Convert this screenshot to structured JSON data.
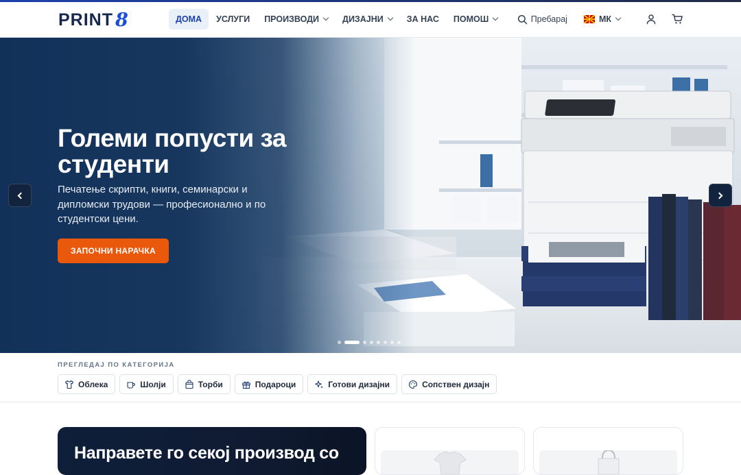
{
  "brand": {
    "name": "PRINT",
    "digit": "8"
  },
  "nav": {
    "items": [
      {
        "label": "ДОМА",
        "active": true,
        "has_dropdown": false
      },
      {
        "label": "УСЛУГИ",
        "active": false,
        "has_dropdown": false
      },
      {
        "label": "ПРОИЗВОДИ",
        "active": false,
        "has_dropdown": true
      },
      {
        "label": "ДИЗАЈНИ",
        "active": false,
        "has_dropdown": true
      },
      {
        "label": "ЗА НАС",
        "active": false,
        "has_dropdown": false
      },
      {
        "label": "ПОМОШ",
        "active": false,
        "has_dropdown": true
      }
    ]
  },
  "tools": {
    "search_label": "Пребарај",
    "search_icon": "search-icon",
    "language": "МК",
    "language_flag": "macedonia-flag-icon",
    "user_icon": "user-icon",
    "cart_icon": "cart-icon"
  },
  "hero": {
    "title": "Големи попусти за студенти",
    "subtitle": "Печатење скрипти, книги, семинарски и дипломски трудови — професионално и по студентски цени.",
    "cta_label": "ЗАПОЧНИ НАРАЧКА",
    "cta_color": "#ea580c",
    "slide_count": 8,
    "active_slide": 2,
    "prev_icon": "chevron-left-icon",
    "next_icon": "chevron-right-icon"
  },
  "categories": {
    "heading": "ПРЕГЛЕДАЈ ПО КАТЕГОРИЈА",
    "items": [
      {
        "label": "Облека",
        "icon": "shirt-icon"
      },
      {
        "label": "Шолји",
        "icon": "mug-icon"
      },
      {
        "label": "Торби",
        "icon": "bag-icon"
      },
      {
        "label": "Подароци",
        "icon": "gift-icon"
      },
      {
        "label": "Готови дизајни",
        "icon": "sparkles-icon"
      },
      {
        "label": "Сопствен дизајн",
        "icon": "palette-icon"
      }
    ]
  },
  "promo": {
    "title": "Направете го секој производ со"
  },
  "colors": {
    "navy": "#16294d",
    "accent_blue": "#1e40af",
    "orange": "#ea580c"
  }
}
